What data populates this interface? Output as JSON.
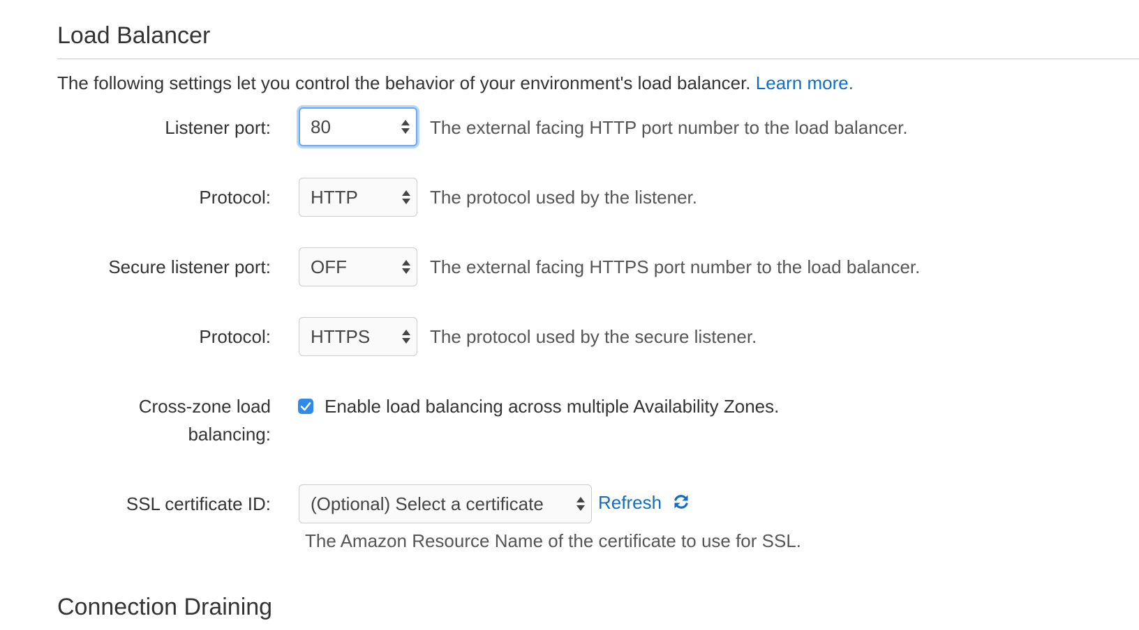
{
  "section": {
    "title": "Load Balancer",
    "intro_text": "The following settings let you control the behavior of your environment's load balancer.",
    "learn_more": "Learn more."
  },
  "fields": {
    "listener_port": {
      "label": "Listener port:",
      "value": "80",
      "help": "The external facing HTTP port number to the load balancer."
    },
    "protocol": {
      "label": "Protocol:",
      "value": "HTTP",
      "help": "The protocol used by the listener."
    },
    "secure_listener_port": {
      "label": "Secure listener port:",
      "value": "OFF",
      "help": "The external facing HTTPS port number to the load balancer."
    },
    "secure_protocol": {
      "label": "Protocol:",
      "value": "HTTPS",
      "help": "The protocol used by the secure listener."
    },
    "cross_zone": {
      "label": "Cross-zone load balancing:",
      "checked": true,
      "checkbox_label": "Enable load balancing across multiple Availability Zones."
    },
    "ssl_certificate": {
      "label": "SSL certificate ID:",
      "placeholder": "(Optional) Select a certificate",
      "refresh": "Refresh",
      "help": "The Amazon Resource Name of the certificate to use for SSL."
    }
  },
  "next_section": {
    "title": "Connection Draining"
  },
  "icons": {
    "select_arrows": "up-down-arrows-icon",
    "checkbox": "checkmark-icon",
    "refresh": "refresh-icon"
  },
  "colors": {
    "link": "#0f6ec4",
    "focus_ring": "#6aa9f2",
    "checkbox": "#2f8ae8"
  }
}
